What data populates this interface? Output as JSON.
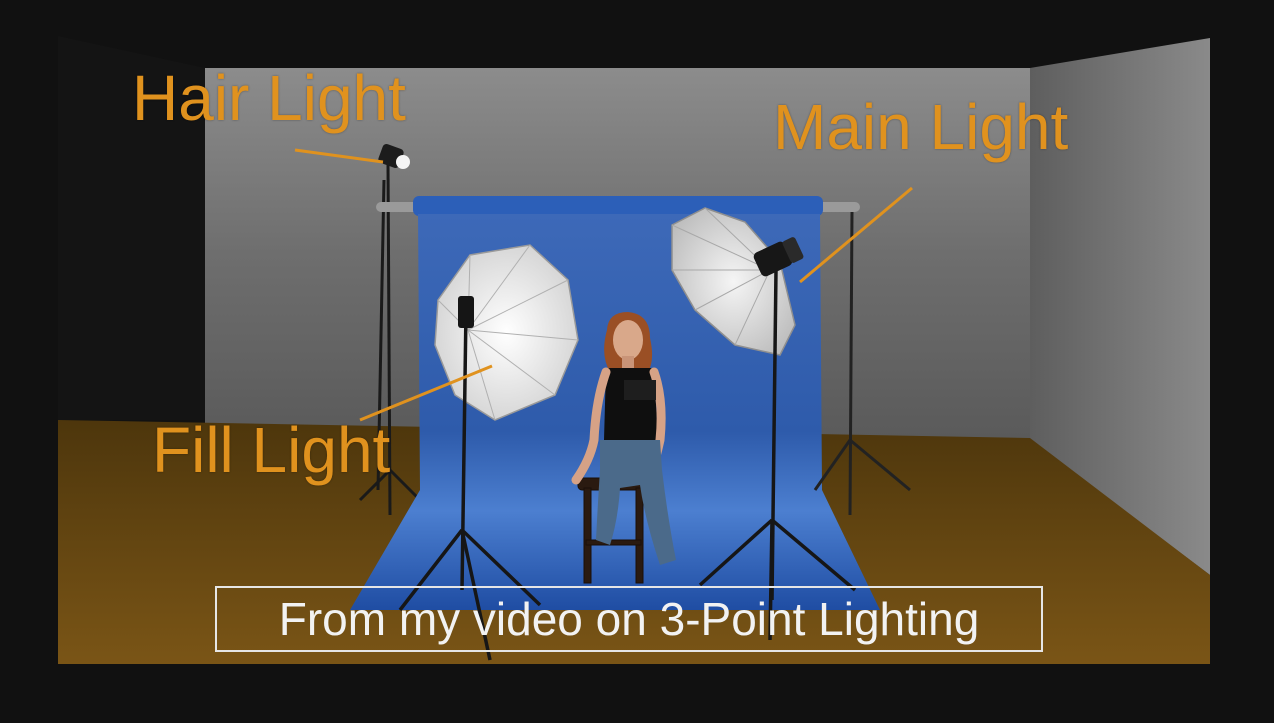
{
  "labels": {
    "hair_light": "Hair Light",
    "main_light": "Main Light",
    "fill_light": "Fill Light"
  },
  "caption": "From my video on 3-Point Lighting",
  "colors": {
    "label_orange": "#E0921E",
    "backdrop_blue": "#2E5DB0",
    "floor_brown": "#6B4A12",
    "wall_gray": "#7A7A7A",
    "frame_black": "#111111"
  }
}
